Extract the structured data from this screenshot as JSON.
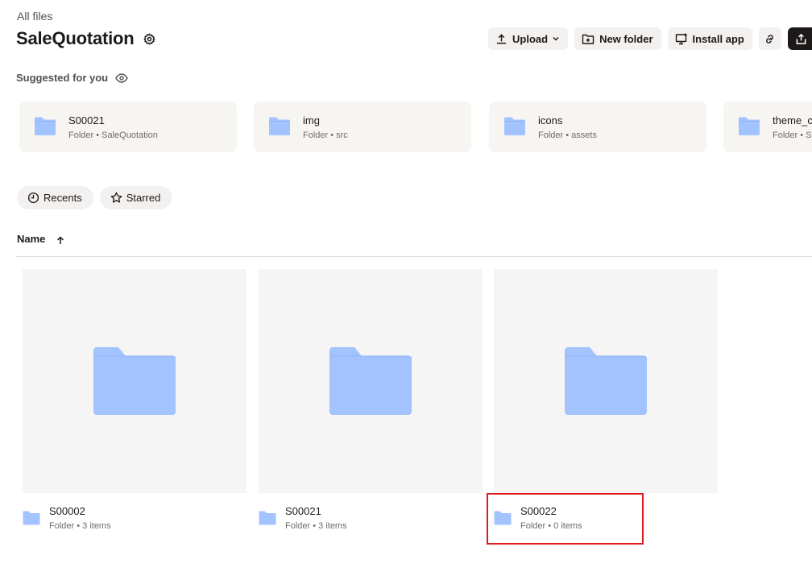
{
  "breadcrumb": "All files",
  "page_title": "SaleQuotation",
  "toolbar": {
    "upload_label": "Upload",
    "new_folder_label": "New folder",
    "install_app_label": "Install app"
  },
  "suggested": {
    "label": "Suggested for you",
    "items": [
      {
        "name": "S00021",
        "meta": "Folder • SaleQuotation"
      },
      {
        "name": "img",
        "meta": "Folder • src"
      },
      {
        "name": "icons",
        "meta": "Folder • assets"
      },
      {
        "name": "theme_c",
        "meta": "Folder • S"
      }
    ]
  },
  "filters": {
    "recents_label": "Recents",
    "starred_label": "Starred"
  },
  "sort": {
    "column_label": "Name",
    "direction": "ascending"
  },
  "files": [
    {
      "name": "S00002",
      "meta": "Folder • 3 items"
    },
    {
      "name": "S00021",
      "meta": "Folder • 3 items"
    },
    {
      "name": "S00022",
      "meta": "Folder • 0 items"
    }
  ],
  "colors": {
    "folder": "#a3c3ff",
    "folder_tab": "#8fb3f5",
    "highlight": "#e01b1b",
    "card_bg": "#f7f5f2"
  }
}
